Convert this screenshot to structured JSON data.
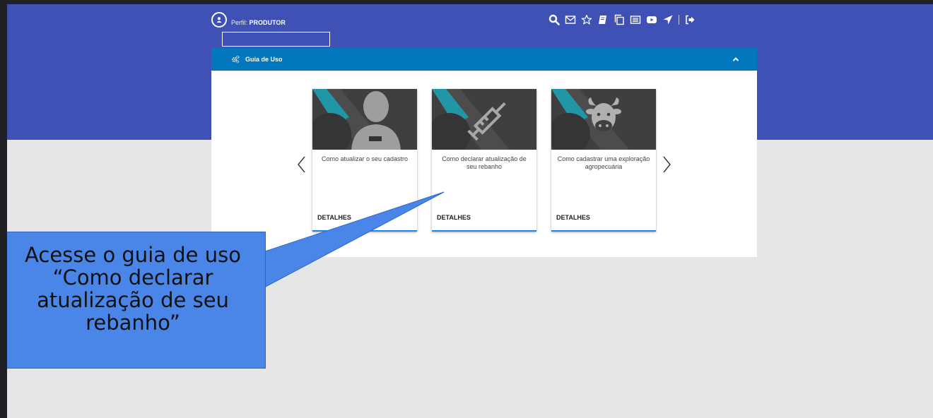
{
  "header": {
    "perfil_label": "Perfil:",
    "perfil_value": "PRODUTOR",
    "colors": {
      "band": "#3f51b5",
      "panel_header": "#0277bd",
      "card_accent": "#1e88e5"
    },
    "toolbar_icons": [
      "search-icon",
      "envelope-icon",
      "star-icon",
      "book-icon",
      "copy-icon",
      "list-icon",
      "youtube-icon",
      "location-arrow-icon",
      "sign-out-icon"
    ]
  },
  "panel": {
    "title": "Guia de Uso",
    "cards": [
      {
        "icon": "person-silhouette",
        "text": "Como atualizar o seu cadastro",
        "link": "DETALHES"
      },
      {
        "icon": "syringe",
        "text": "Como declarar atualização de seu rebanho",
        "link": "DETALHES"
      },
      {
        "icon": "cow",
        "text": "Como cadastrar uma exploração agropecuária",
        "link": "DETALHES"
      }
    ]
  },
  "callout": {
    "lines": [
      "Acesse o guia de uso",
      "“Como declarar",
      "atualização de seu",
      "rebanho”"
    ],
    "color": "#4a86e8"
  }
}
